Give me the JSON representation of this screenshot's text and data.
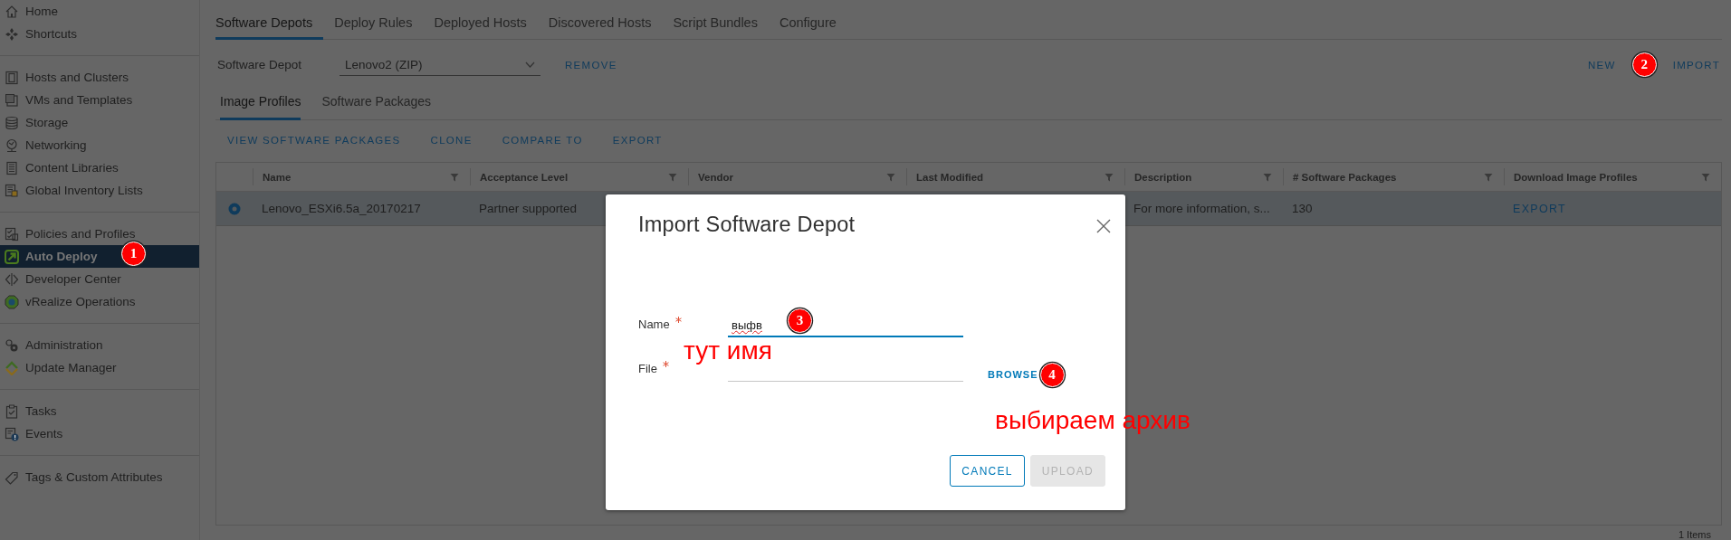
{
  "sidebar": {
    "groups": [
      {
        "items": [
          {
            "label": "Home",
            "selected": false
          },
          {
            "label": "Shortcuts",
            "selected": false
          }
        ]
      },
      {
        "items": [
          {
            "label": "Hosts and Clusters",
            "selected": false
          },
          {
            "label": "VMs and Templates",
            "selected": false
          },
          {
            "label": "Storage",
            "selected": false
          },
          {
            "label": "Networking",
            "selected": false
          },
          {
            "label": "Content Libraries",
            "selected": false
          },
          {
            "label": "Global Inventory Lists",
            "selected": false
          }
        ]
      },
      {
        "items": [
          {
            "label": "Policies and Profiles",
            "selected": false
          },
          {
            "label": "Auto Deploy",
            "selected": true
          },
          {
            "label": "Developer Center",
            "selected": false
          },
          {
            "label": "vRealize Operations",
            "selected": false
          }
        ]
      },
      {
        "items": [
          {
            "label": "Administration",
            "selected": false
          },
          {
            "label": "Update Manager",
            "selected": false
          }
        ]
      },
      {
        "items": [
          {
            "label": "Tasks",
            "selected": false
          },
          {
            "label": "Events",
            "selected": false
          }
        ]
      },
      {
        "items": [
          {
            "label": "Tags & Custom Attributes",
            "selected": false
          }
        ]
      }
    ]
  },
  "tabs": [
    {
      "label": "Software Depots",
      "selected": true
    },
    {
      "label": "Deploy Rules",
      "selected": false
    },
    {
      "label": "Deployed Hosts",
      "selected": false
    },
    {
      "label": "Discovered Hosts",
      "selected": false
    },
    {
      "label": "Script Bundles",
      "selected": false
    },
    {
      "label": "Configure",
      "selected": false
    }
  ],
  "depot": {
    "label": "Software Depot",
    "value": "Lenovo2 (ZIP)",
    "remove": "REMOVE",
    "actions": [
      "NEW",
      "IMPORT"
    ]
  },
  "subtabs": [
    {
      "label": "Image Profiles",
      "selected": true
    },
    {
      "label": "Software Packages",
      "selected": false
    }
  ],
  "toolbar": [
    "VIEW SOFTWARE PACKAGES",
    "CLONE",
    "COMPARE TO",
    "EXPORT"
  ],
  "table": {
    "columns": [
      "Name",
      "Acceptance Level",
      "Vendor",
      "Last Modified",
      "Description",
      "# Software Packages",
      "Download Image Profiles"
    ],
    "rows": [
      {
        "selected": true,
        "name": "Lenovo_ESXi6.5a_20170217",
        "acceptance_level": "Partner supported",
        "description": "For more information, s...",
        "software_packages": "130",
        "download": "EXPORT"
      }
    ],
    "footer": "1 Items"
  },
  "dialog": {
    "title": "Import Software Depot",
    "fields": [
      {
        "label": "Name",
        "required": true,
        "value": "выфв",
        "focused": true,
        "misspelled": true
      },
      {
        "label": "File",
        "required": true,
        "focused": false,
        "misspelled": false
      }
    ],
    "browse": "BROWSE",
    "buttons": [
      {
        "label": "CANCEL",
        "disabled": false
      },
      {
        "label": "UPLOAD",
        "disabled": true
      }
    ]
  },
  "annotations": {
    "badges": [
      "1",
      "2",
      "3",
      "4"
    ],
    "notes": [
      "тут имя",
      "выбираем архив"
    ]
  }
}
